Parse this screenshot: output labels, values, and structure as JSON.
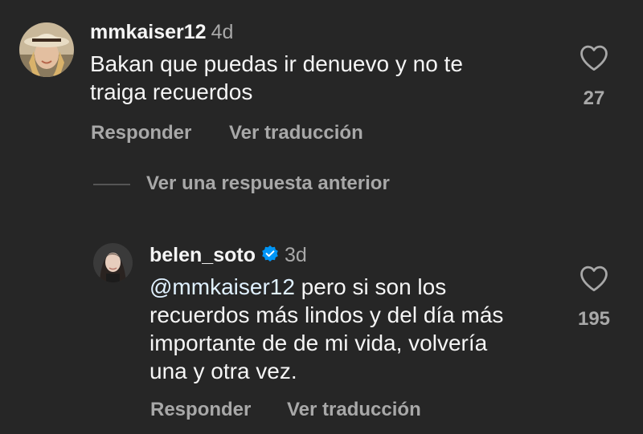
{
  "comment1": {
    "username": "mmkaiser12",
    "time": "4d",
    "text": "Bakan que puedas ir denuevo y no te traiga recuerdos",
    "text_line1": "Bakan que puedas ir denuevo y no te",
    "text_line2": "traiga recuerdos",
    "likes": "27",
    "reply_label": "Responder",
    "translate_label": "Ver traducción"
  },
  "view_replies_label": "Ver una respuesta anterior",
  "reply1": {
    "username": "belen_soto",
    "verified": true,
    "time": "3d",
    "mention": "@mmkaiser12",
    "text_line1_rest": " pero si son los",
    "text_line2": "recuerdos más lindos y del día más",
    "text_line3": "importante de de mi vida, volvería",
    "text_line4": "una y otra vez.",
    "likes": "195",
    "reply_label": "Responder",
    "translate_label": "Ver traducción"
  },
  "colors": {
    "background": "#262626",
    "primary_text": "#f5f5f5",
    "secondary_text": "#a8a8a8",
    "verified_badge": "#0095f6"
  },
  "icons": [
    "heart-icon",
    "verified-badge-icon"
  ]
}
